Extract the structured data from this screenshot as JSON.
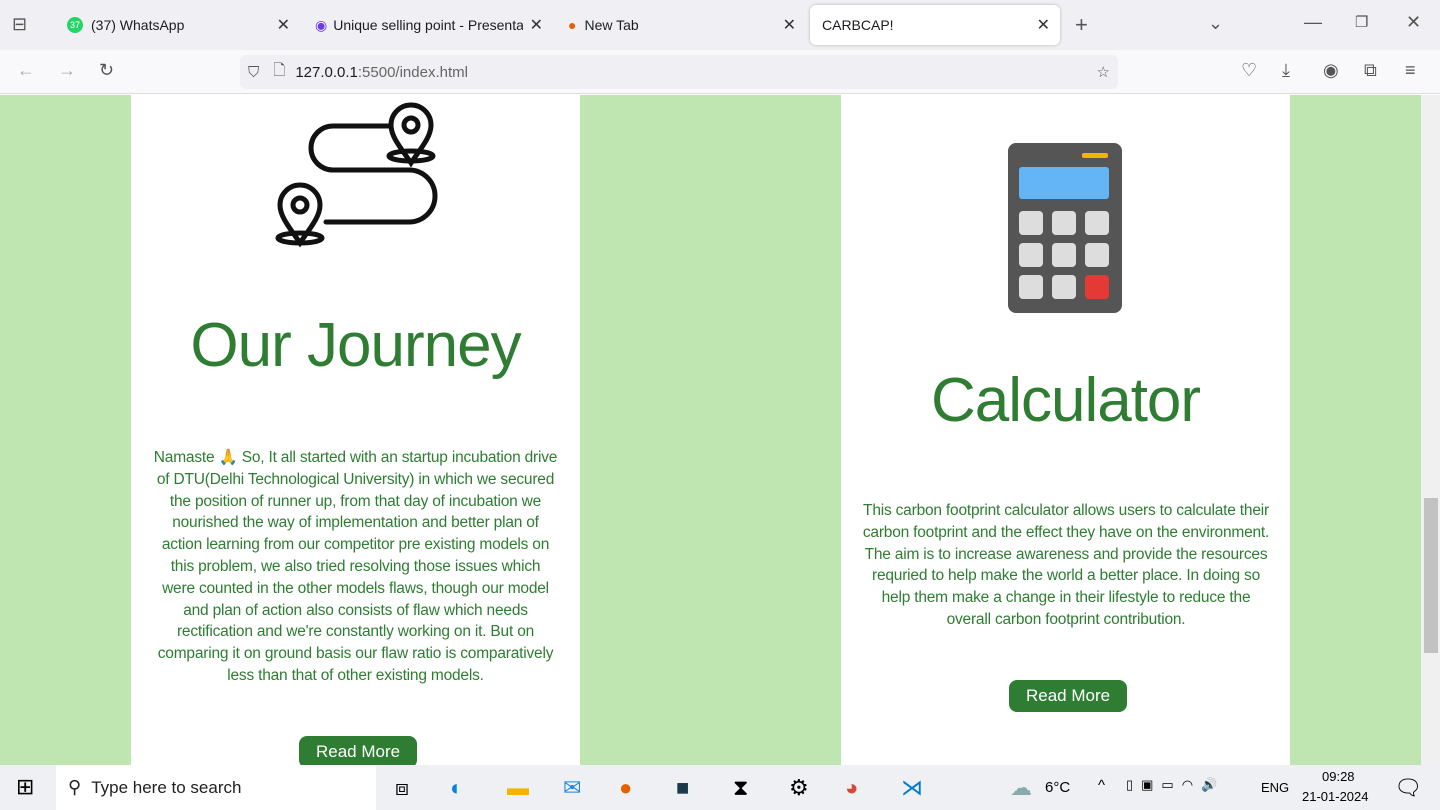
{
  "browser": {
    "tabs": [
      {
        "label": "(37) WhatsApp",
        "badge": "37",
        "active": false
      },
      {
        "label": "Unique selling point - Presentat",
        "active": false
      },
      {
        "label": "New Tab",
        "active": false
      },
      {
        "label": "CARBCAP!",
        "active": true
      }
    ],
    "url_host": "127.0.0.1",
    "url_path": ":5500/index.html"
  },
  "cards": [
    {
      "title": "Our Journey",
      "icon": "route-map-pins-icon",
      "text": "Namaste 🙏 So, It all started with an startup incubation drive of DTU(Delhi Technological University) in which we secured the position of runner up, from that day of incubation we nourished the way of implementation and better plan of action learning from our competitor pre existing models on this problem, we also tried resolving those issues which were counted in the other models flaws, though our model and plan of action also consists of flaw which needs rectification and we're constantly working on it. But on comparing it on ground basis our flaw ratio is comparatively less than that of other existing models.",
      "button": "Read More"
    },
    {
      "title": "Calculator",
      "icon": "calculator-icon",
      "text": "This carbon footprint calculator allows users to calculate their carbon footprint and the effect they have on the environment. The aim is to increase awareness and provide the resources requried to help make the world a better place. In doing so help them make a change in their lifestyle to reduce the overall carbon footprint contribution.",
      "button": "Read More"
    }
  ],
  "colors": {
    "page_bg": "#bfe5b0",
    "accent": "#2e7d32"
  },
  "taskbar": {
    "search_placeholder": "Type here to search",
    "weather": "6°C",
    "language": "ENG",
    "time": "09:28",
    "date": "21-01-2024"
  }
}
